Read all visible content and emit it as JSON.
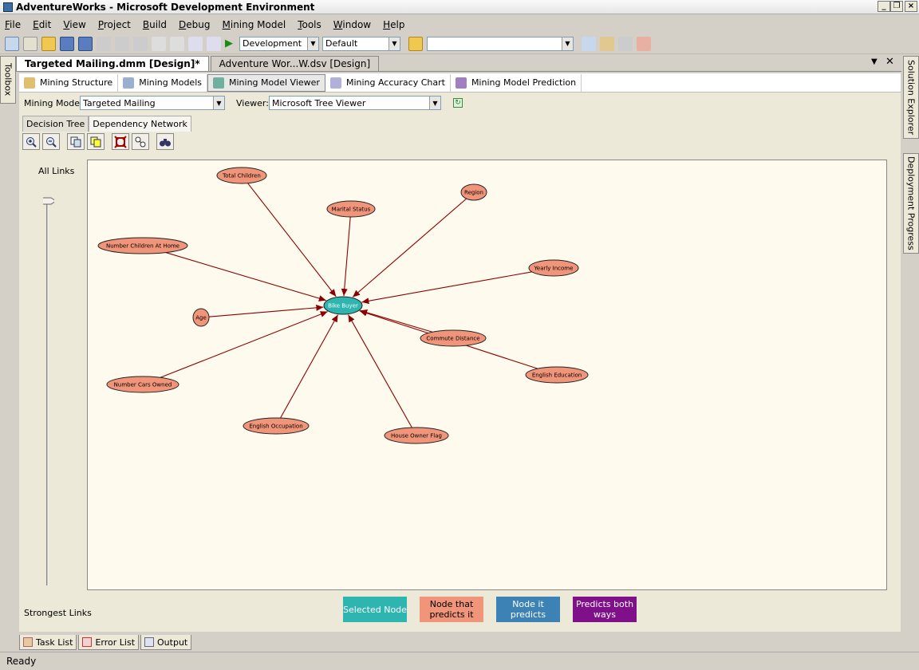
{
  "window": {
    "title": "AdventureWorks - Microsoft Development Environment",
    "buttons": [
      "_",
      "❐",
      "×"
    ]
  },
  "menu": [
    "File",
    "Edit",
    "View",
    "Project",
    "Build",
    "Debug",
    "Mining Model",
    "Tools",
    "Window",
    "Help"
  ],
  "toolbar": {
    "config": "Development",
    "platform": "Default",
    "search": ""
  },
  "side": {
    "left": "Toolbox",
    "right_top": "Solution Explorer",
    "right_bottom": "Deployment Progress"
  },
  "doc_tabs": [
    {
      "label": "Targeted Mailing.dmm [Design]*",
      "active": true
    },
    {
      "label": "Adventure Wor...W.dsv [Design]",
      "active": false
    }
  ],
  "designer_tabs": [
    {
      "label": "Mining Structure",
      "active": false
    },
    {
      "label": "Mining Models",
      "active": false
    },
    {
      "label": "Mining Model Viewer",
      "active": true
    },
    {
      "label": "Mining Accuracy Chart",
      "active": false
    },
    {
      "label": "Mining Model Prediction",
      "active": false
    }
  ],
  "model_bar": {
    "mining_model_label": "Mining Model:",
    "mining_model_value": "Targeted Mailing",
    "viewer_label": "Viewer:",
    "viewer_value": "Microsoft Tree Viewer"
  },
  "view_tabs": [
    {
      "label": "Decision Tree",
      "active": false
    },
    {
      "label": "Dependency Network",
      "active": true
    }
  ],
  "slider": {
    "top_label": "All Links",
    "bottom_label": "Strongest Links",
    "level": 1.0
  },
  "network": {
    "center": "Bike Buyer",
    "nodes": [
      "Total Children",
      "Region",
      "Marital Status",
      "Number Children At Home",
      "Yearly Income",
      "Age",
      "Commute Distance",
      "English Education",
      "Number Cars Owned",
      "English Occupation",
      "House Owner Flag"
    ]
  },
  "legend": [
    {
      "label": "Selected Node",
      "color": "#2fb5b0"
    },
    {
      "label": "Node that predicts it",
      "color": "#f0947a"
    },
    {
      "label": "Node it predicts",
      "color": "#3c82b4"
    },
    {
      "label": "Predicts both ways",
      "color": "#80108a"
    }
  ],
  "bottom_tabs": [
    "Task List",
    "Error List",
    "Output"
  ],
  "status": "Ready"
}
